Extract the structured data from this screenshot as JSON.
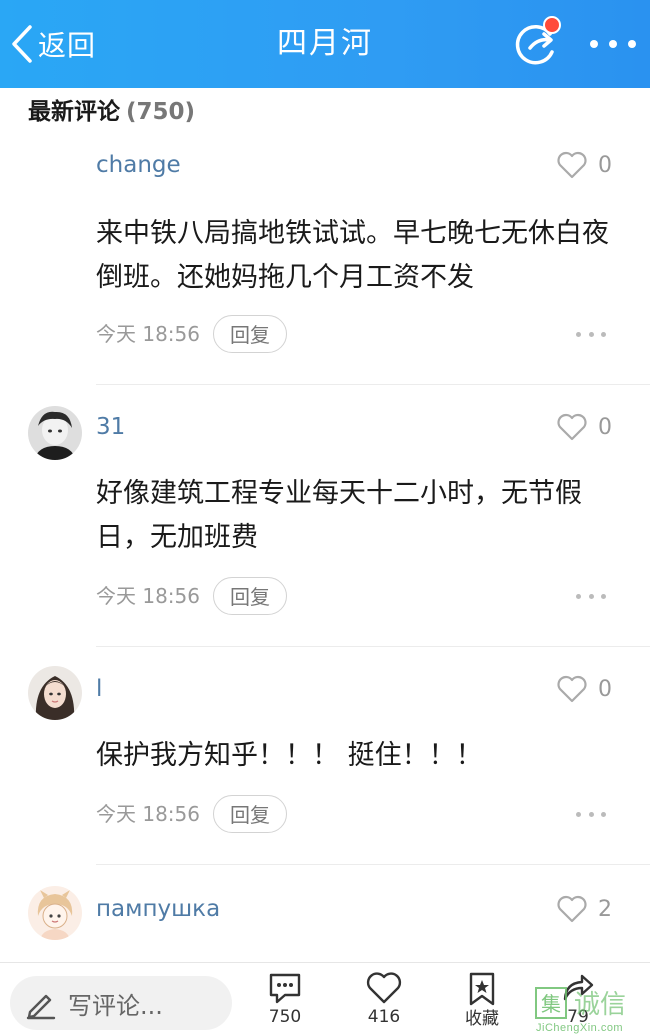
{
  "topbar": {
    "back_label": "返回",
    "title": "四月河",
    "bg_color": "#2f9cf3",
    "notification_color": "#ff4b3a"
  },
  "section": {
    "title": "最新评论",
    "count": "(750)"
  },
  "comments": [
    {
      "author": "change",
      "likes": "0",
      "text": "来中铁八局搞地铁试试。早七晚七无休白夜倒班。还她妈拖几个月工资不发",
      "time": "今天 18:56",
      "reply_label": "回复",
      "has_avatar": false
    },
    {
      "author": "31",
      "likes": "0",
      "text": "好像建筑工程专业每天十二小时，无节假日，无加班费",
      "time": "今天 18:56",
      "reply_label": "回复",
      "has_avatar": true
    },
    {
      "author": "l",
      "likes": "0",
      "text": "保护我方知乎！！！ 挺住！！！",
      "time": "今天 18:56",
      "reply_label": "回复",
      "has_avatar": true
    },
    {
      "author": "пампушка",
      "likes": "2",
      "has_avatar": true
    }
  ],
  "bottombar": {
    "write_placeholder": "写评论...",
    "comment_count": "750",
    "like_count": "416",
    "favorite_label": "收藏",
    "share_count": "79"
  },
  "watermark": {
    "url": "JiChengXin.com"
  }
}
